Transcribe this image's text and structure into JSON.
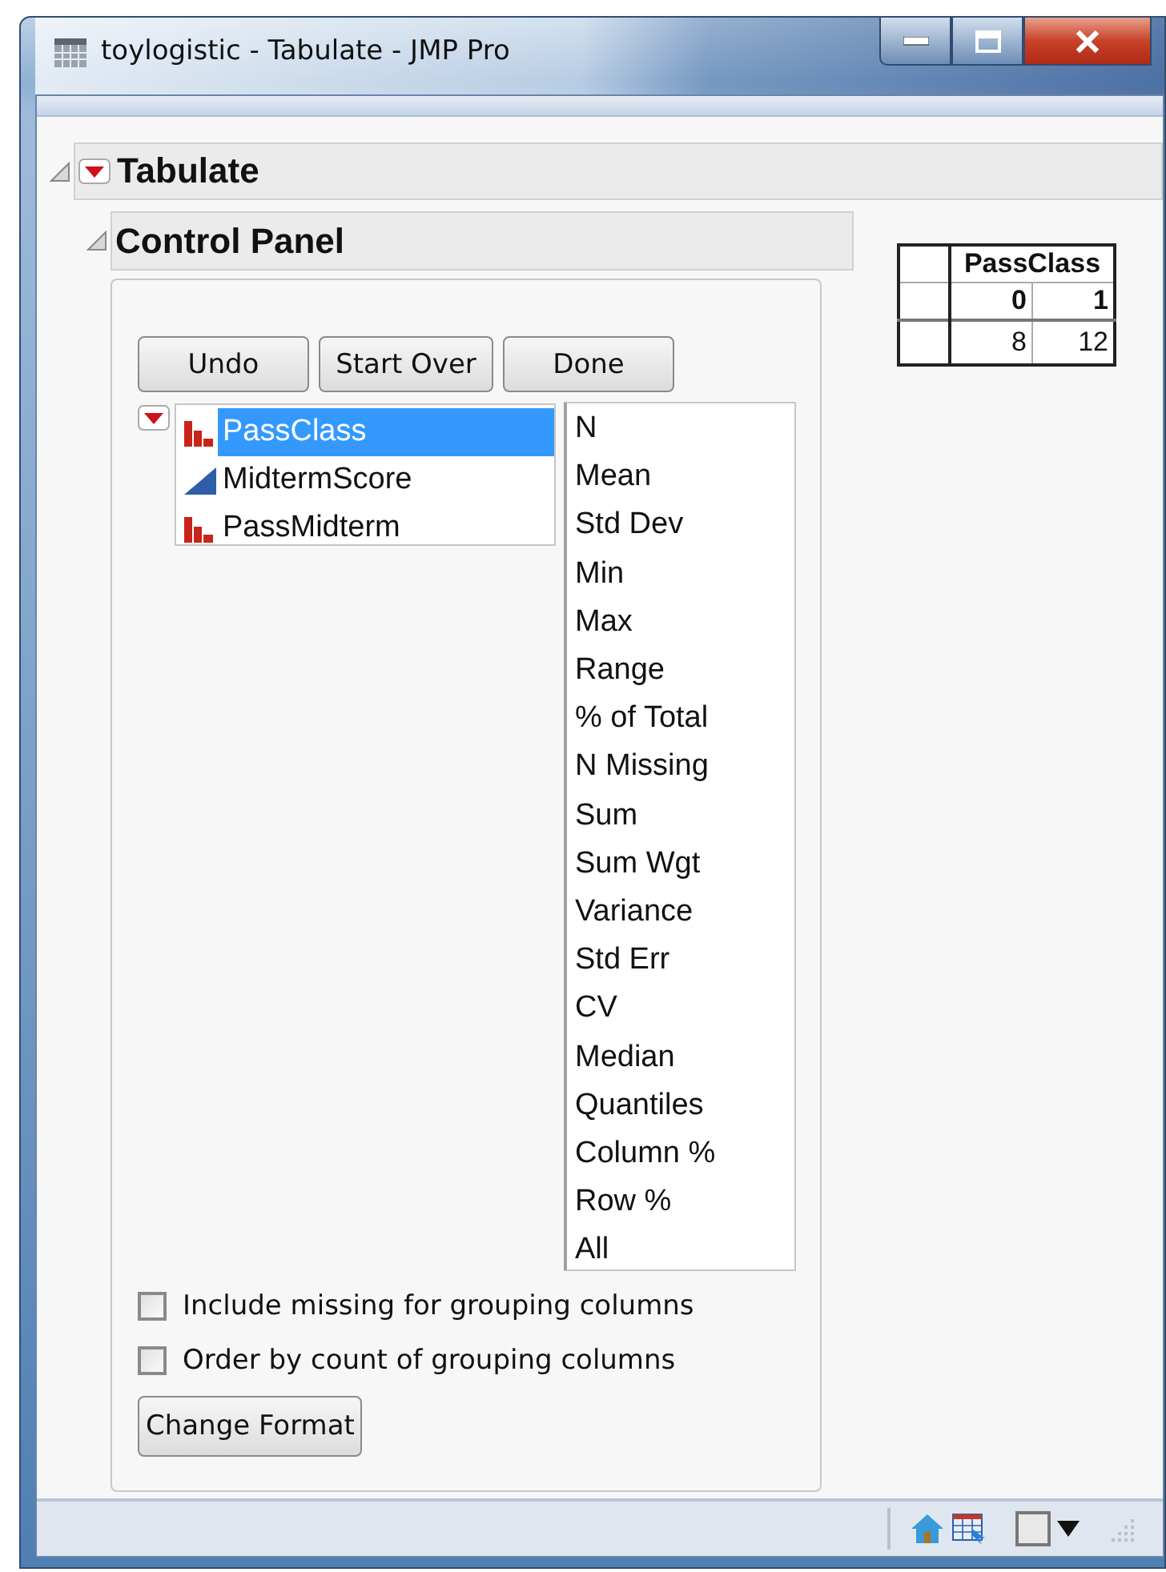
{
  "window": {
    "title": "toylogistic - Tabulate - JMP Pro"
  },
  "report": {
    "title": "Tabulate",
    "expanded": true
  },
  "control_panel": {
    "title": "Control Panel",
    "expanded": true,
    "buttons": [
      "Undo",
      "Start Over",
      "Done"
    ],
    "columns": [
      {
        "name": "PassClass",
        "kind": "nominal",
        "selected": true
      },
      {
        "name": "MidtermScore",
        "kind": "continuous",
        "selected": false
      },
      {
        "name": "PassMidterm",
        "kind": "nominal",
        "selected": false
      }
    ],
    "statistics": [
      "N",
      "Mean",
      "Std Dev",
      "Min",
      "Max",
      "Range",
      "% of Total",
      "N Missing",
      "Sum",
      "Sum Wgt",
      "Variance",
      "Std Err",
      "CV",
      "Median",
      "Quantiles",
      "Column %",
      "Row %",
      "All"
    ],
    "options": [
      {
        "label": "Include missing for grouping columns",
        "checked": false
      },
      {
        "label": "Order by count of grouping columns",
        "checked": false
      }
    ],
    "format_button": "Change Format"
  },
  "table": {
    "column_header": "PassClass",
    "levels": [
      "0",
      "1"
    ],
    "counts": [
      "8",
      "12"
    ]
  }
}
